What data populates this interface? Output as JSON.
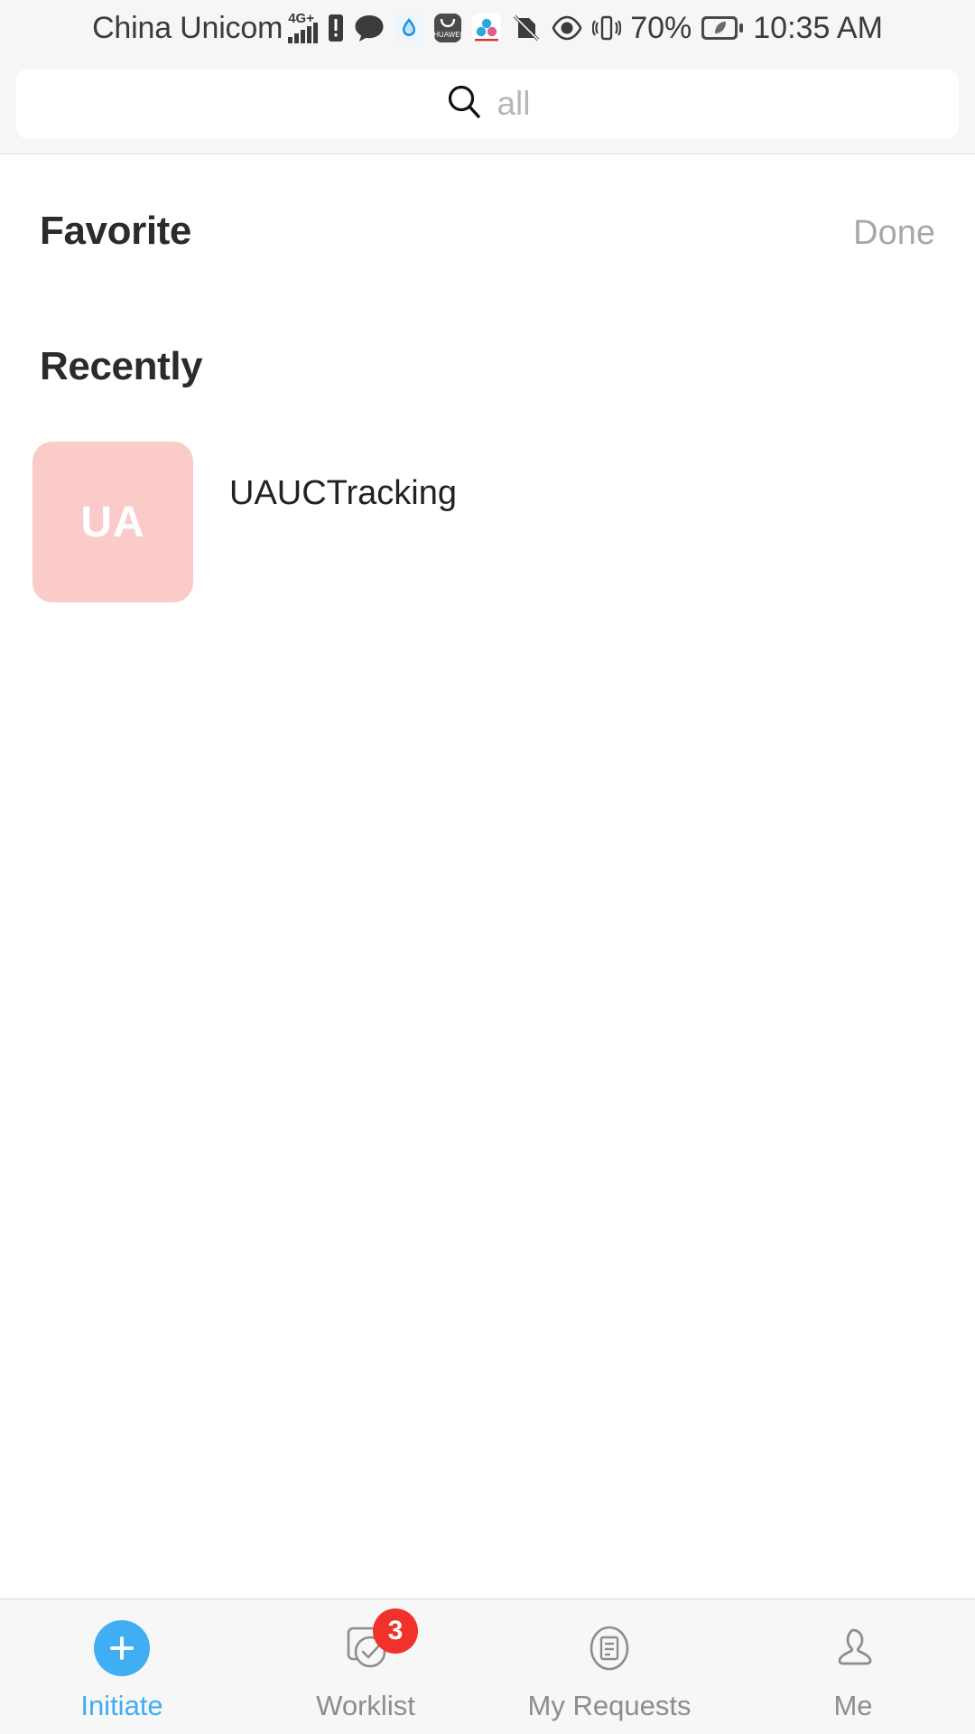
{
  "statusbar": {
    "carrier": "China Unicom",
    "network": "4G+",
    "battery_percent": "70%",
    "clock": "10:35 AM",
    "icons": [
      "signal-bars-icon",
      "sim-alert-icon",
      "message-bubble-icon",
      "browser-icon",
      "huawei-app-icon",
      "cloud-sync-icon",
      "no-sim-icon",
      "eye-comfort-icon",
      "vibrate-icon",
      "battery-saver-icon"
    ]
  },
  "search": {
    "value": "",
    "placeholder": "all",
    "icon": "search-icon"
  },
  "favorite": {
    "title": "Favorite",
    "action_label": "Done",
    "items": []
  },
  "recently": {
    "title": "Recently",
    "items": [
      {
        "initials": "UA",
        "name": "UAUCTracking",
        "tile_color": "#FACBC9"
      }
    ]
  },
  "tabbar": {
    "active_color": "#3FAEF3",
    "inactive_color": "#8D8D8D",
    "badge_color": "#F0322B",
    "tabs": [
      {
        "label": "Initiate",
        "icon": "plus-circle-icon",
        "active": true,
        "badge": ""
      },
      {
        "label": "Worklist",
        "icon": "checklist-icon",
        "active": false,
        "badge": "3"
      },
      {
        "label": "My Requests",
        "icon": "document-circle-icon",
        "active": false,
        "badge": ""
      },
      {
        "label": "Me",
        "icon": "person-icon",
        "active": false,
        "badge": ""
      }
    ]
  }
}
